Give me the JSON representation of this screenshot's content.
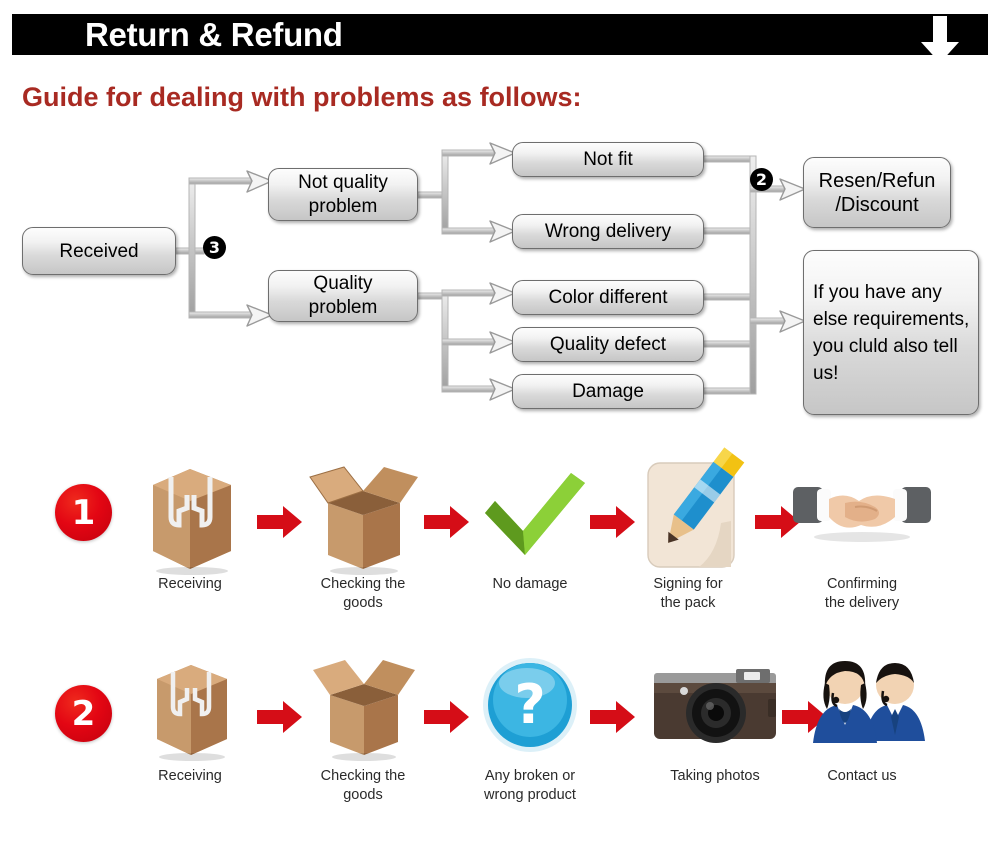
{
  "header": {
    "title": "Return & Refund",
    "arrow_icon": "down-arrow-icon",
    "bar_color": "#000000",
    "text_color": "#ffffff"
  },
  "guide": {
    "heading": "Guide for dealing with problems as follows:",
    "color": "#a82a22"
  },
  "flowchart": {
    "start": {
      "label": "Received"
    },
    "markers": [
      {
        "id": "marker-3",
        "label": "3"
      },
      {
        "id": "marker-2",
        "label": "2"
      }
    ],
    "branches": [
      {
        "label": "Not quality\nproblem",
        "line1": "Not quality",
        "line2": "problem"
      },
      {
        "label": "Quality\nproblem",
        "line1": "Quality",
        "line2": "problem"
      }
    ],
    "issues": [
      {
        "label": "Not fit"
      },
      {
        "label": "Wrong delivery"
      },
      {
        "label": "Color different"
      },
      {
        "label": "Quality defect"
      },
      {
        "label": "Damage"
      }
    ],
    "outcomes": [
      {
        "line1": "Resen/Refun",
        "line2": "/Discount"
      },
      {
        "text": "If you have any else requirements, you cluld also tell us!"
      }
    ]
  },
  "process": {
    "rows": [
      {
        "badge": "1",
        "steps": [
          {
            "icon": "closed-box-icon",
            "caption_line1": "Receiving",
            "caption_line2": ""
          },
          {
            "icon": "open-box-icon",
            "caption_line1": "Checking the",
            "caption_line2": "goods"
          },
          {
            "icon": "green-check-icon",
            "caption_line1": "No damage",
            "caption_line2": ""
          },
          {
            "icon": "pencil-sign-icon",
            "caption_line1": "Signing for",
            "caption_line2": "the pack"
          },
          {
            "icon": "handshake-icon",
            "caption_line1": "Confirming",
            "caption_line2": "the delivery"
          }
        ]
      },
      {
        "badge": "2",
        "steps": [
          {
            "icon": "closed-box-icon",
            "caption_line1": "Receiving",
            "caption_line2": ""
          },
          {
            "icon": "open-box-icon",
            "caption_line1": "Checking the",
            "caption_line2": "goods"
          },
          {
            "icon": "question-mark-icon",
            "caption_line1": "Any broken or",
            "caption_line2": "wrong product"
          },
          {
            "icon": "camera-icon",
            "caption_line1": "Taking photos",
            "caption_line2": ""
          },
          {
            "icon": "support-agents-icon",
            "caption_line1": "Contact us",
            "caption_line2": ""
          }
        ]
      }
    ],
    "arrow_icon": "red-arrow-right-icon",
    "arrow_color": "#d50d17"
  },
  "colors": {
    "box_border": "#6e6e6e",
    "connector": "#bdbdbd",
    "box_fill_top": "#fdfdfd",
    "box_fill_bottom": "#c6c6c6",
    "badge_red": "#e30613",
    "check_green": "#76b82a",
    "question_blue": "#1e9fd4",
    "box_brown": "#c08f5e"
  }
}
